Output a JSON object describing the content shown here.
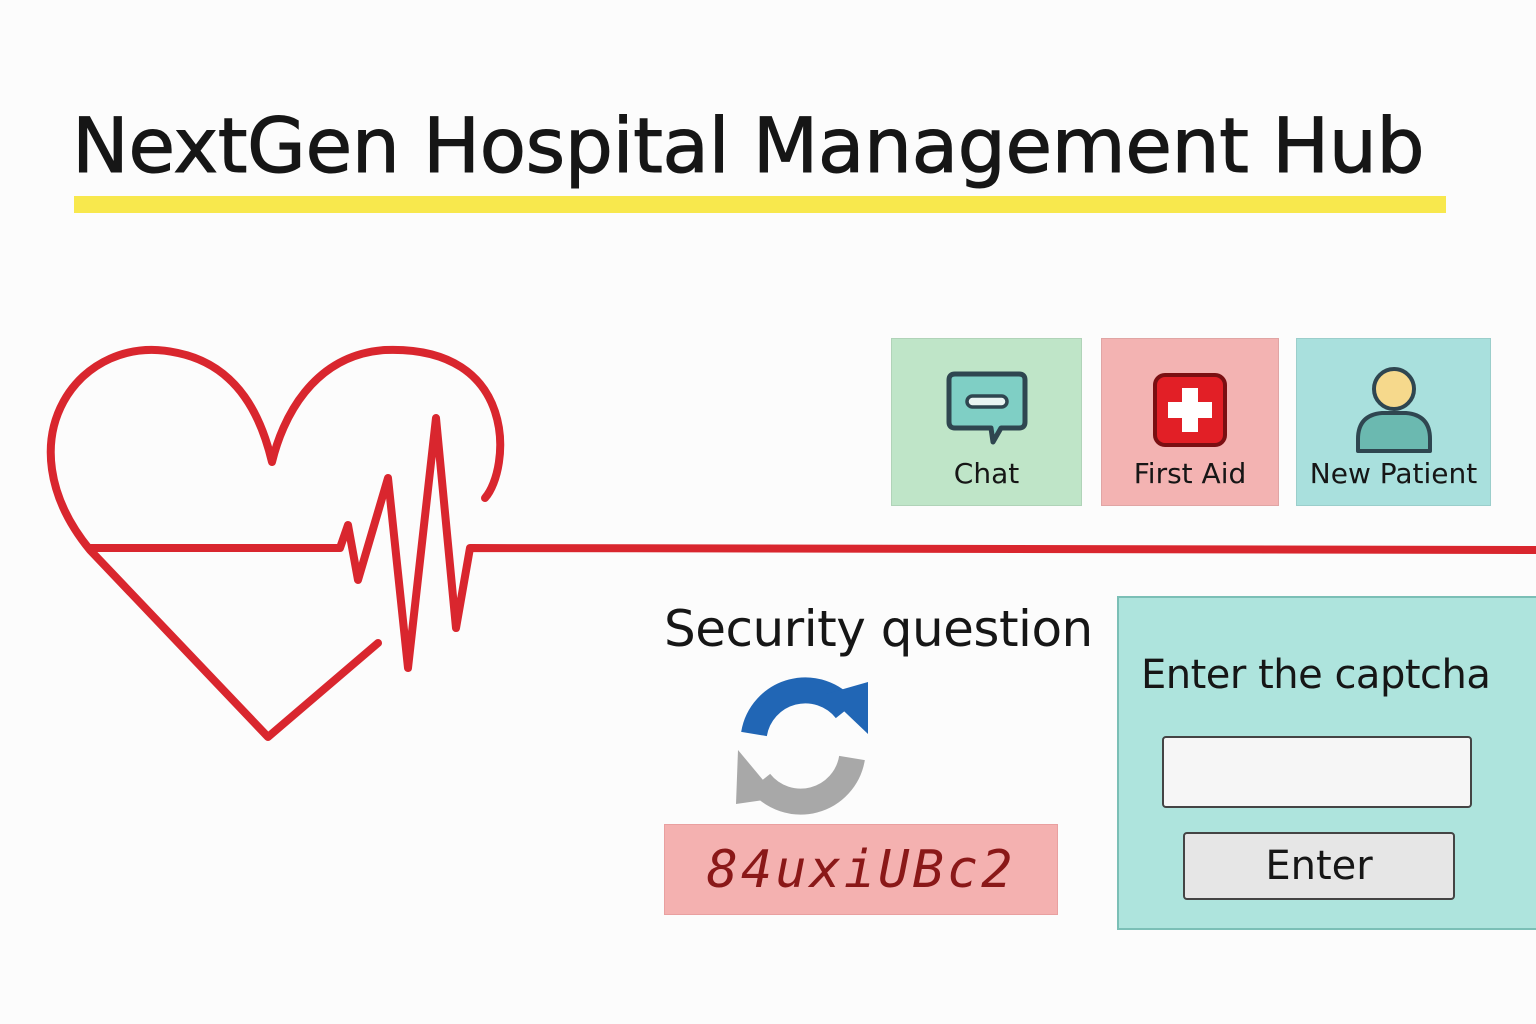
{
  "header": {
    "title": "NextGen Hospital Management Hub"
  },
  "colors": {
    "accent_underline": "#f8e84d",
    "heartbeat_red": "#d9262e",
    "chat_tile": "#bfe5c8",
    "first_aid_tile": "#f3b3b2",
    "new_patient_tile": "#a9e0dd",
    "refresh_blue": "#2166b5",
    "refresh_gray": "#a8a8a8"
  },
  "logo": {
    "icon": "heart-heartbeat-icon"
  },
  "quick_actions": [
    {
      "label": "Chat",
      "icon": "chat-bubble-icon"
    },
    {
      "label": "First Aid",
      "icon": "first-aid-cross-icon"
    },
    {
      "label": "New Patient",
      "icon": "user-icon"
    }
  ],
  "security": {
    "heading": "Security question",
    "refresh_icon": "refresh-icon",
    "captcha_code": "84uxiUBc2"
  },
  "captcha_panel": {
    "label": "Enter the captcha",
    "input_value": "",
    "input_placeholder": "",
    "submit_label": "Enter"
  }
}
